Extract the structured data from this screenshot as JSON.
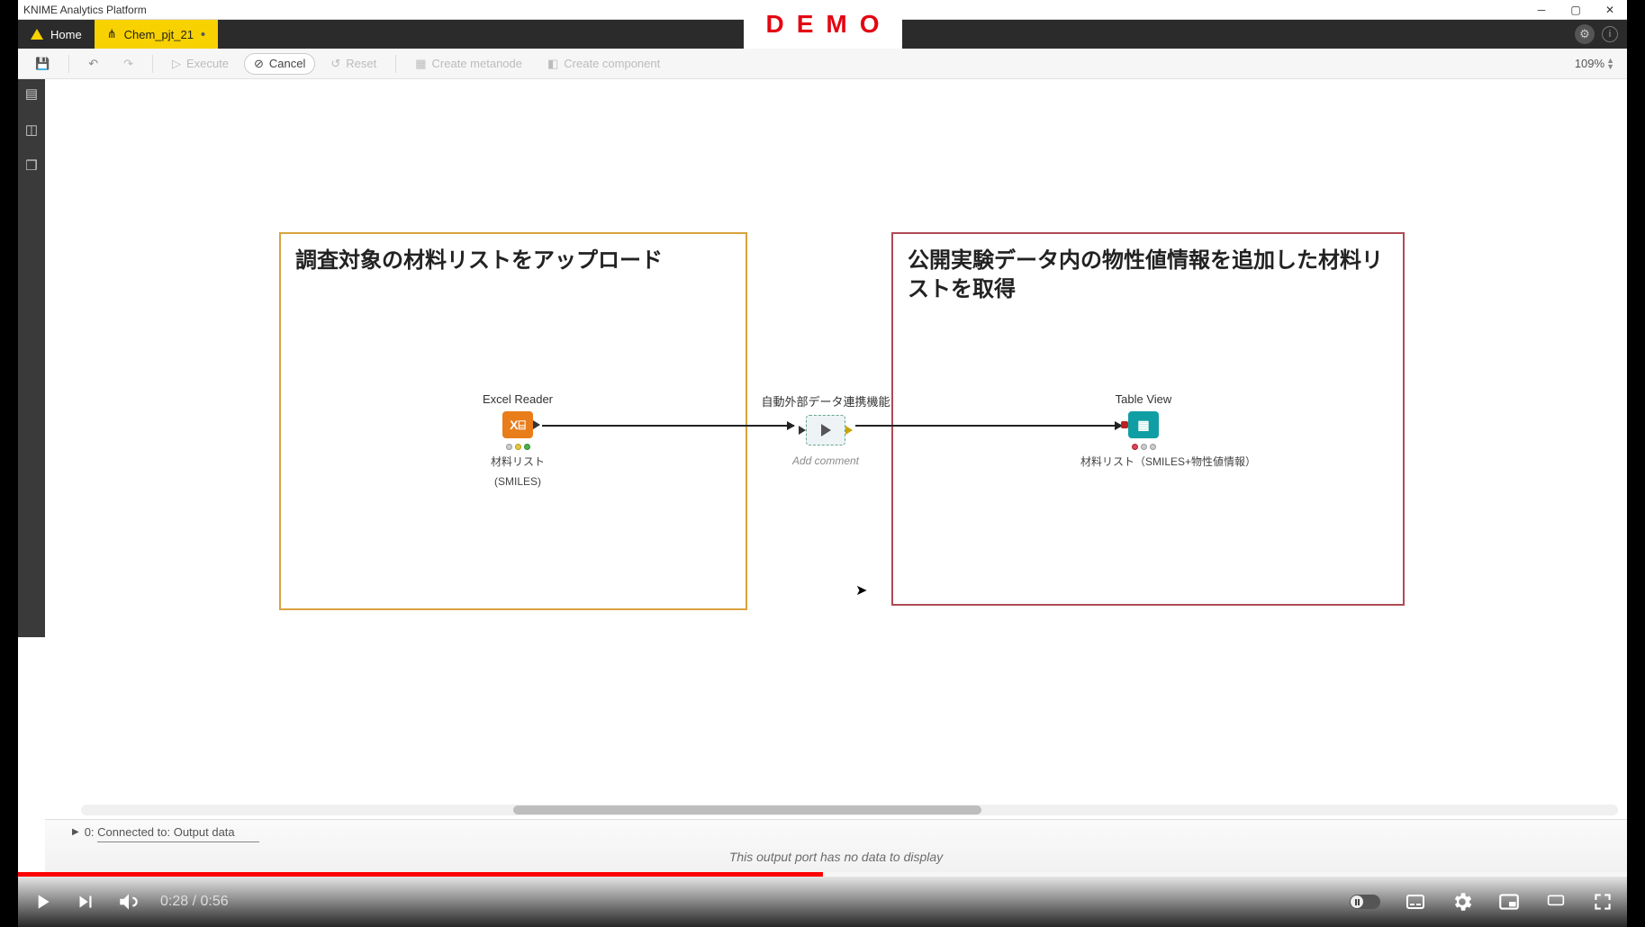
{
  "window": {
    "app_title": "KNIME Analytics Platform"
  },
  "demo_label": "DEMO",
  "tabs": {
    "home_label": "Home",
    "workflow_label": "Chem_pjt_21",
    "dirty_marker": "•"
  },
  "toolbar": {
    "execute": "Execute",
    "cancel": "Cancel",
    "reset": "Reset",
    "create_metanode": "Create metanode",
    "create_component": "Create component",
    "zoom": "109%"
  },
  "annotations": {
    "left_title": "調査対象の材料リストをアップロード",
    "right_title": "公開実験データ内の物性値情報を追加した材料リストを取得"
  },
  "nodes": {
    "excel": {
      "name": "Excel Reader",
      "sub1": "材料リスト",
      "sub2": "(SMILES)"
    },
    "meta": {
      "name": "自動外部データ連携機能",
      "add_comment": "Add comment"
    },
    "table": {
      "name": "Table View",
      "sub": "材料リスト（SMILES+物性値情報）"
    }
  },
  "output_panel": {
    "tab_label": "0: Connected to: Output data",
    "empty_msg": "This output port has no data to display"
  },
  "video": {
    "current": "0:28",
    "duration": "0:56",
    "progress_pct": 50
  }
}
